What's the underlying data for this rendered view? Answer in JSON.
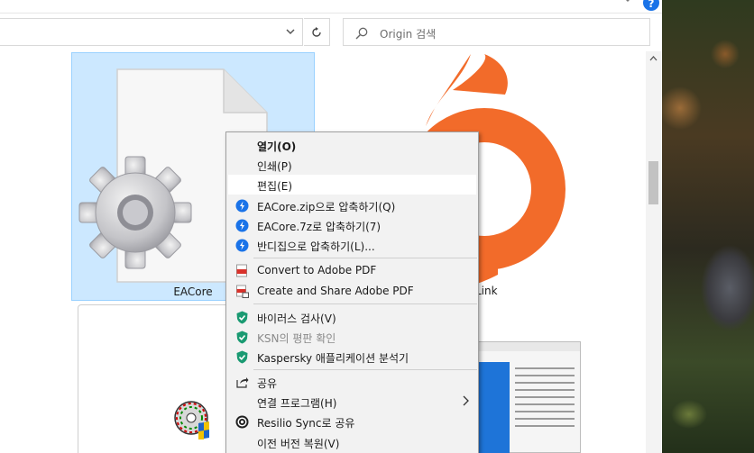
{
  "explorer": {
    "search_placeholder": "Origin 검색",
    "help": "?"
  },
  "files": [
    {
      "name": "EACore",
      "icon": "gear-document-icon",
      "selected": true
    },
    {
      "name": "Link",
      "icon": "origin-logo-icon",
      "selected": false
    }
  ],
  "context_menu": {
    "items": [
      {
        "label": "열기(O)",
        "icon": "",
        "bold": true
      },
      {
        "label": "인쇄(P)",
        "icon": ""
      },
      {
        "label": "편집(E)",
        "icon": "",
        "hover": true
      },
      {
        "label": "EACore.zip으로 압축하기(Q)",
        "icon": "bandizip-icon"
      },
      {
        "label": "EACore.7z로 압축하기(7)",
        "icon": "bandizip-icon"
      },
      {
        "label": "반디집으로 압축하기(L)...",
        "icon": "bandizip-icon"
      },
      {
        "label": "Convert to Adobe PDF",
        "icon": "adobe-pdf-icon"
      },
      {
        "label": "Create and Share Adobe PDF",
        "icon": "adobe-pdf-share-icon"
      },
      {
        "label": "바이러스 검사(V)",
        "icon": "kaspersky-shield-icon"
      },
      {
        "label": "KSN의 평판 확인",
        "icon": "kaspersky-shield-icon",
        "disabled": true
      },
      {
        "label": "Kaspersky 애플리케이션 분석기",
        "icon": "kaspersky-shield-icon"
      },
      {
        "label": "공유",
        "icon": "share-icon"
      },
      {
        "label": "연결 프로그램(H)",
        "icon": "",
        "submenu": true
      },
      {
        "label": "Resilio Sync로 공유",
        "icon": "resilio-sync-icon"
      },
      {
        "label": "이전 버전 복원(V)",
        "icon": ""
      }
    ]
  },
  "colors": {
    "selection": "#cce8ff",
    "origin_orange": "#f26b2a",
    "bandizip_blue": "#1a73e8",
    "kaspersky_green": "#1a9a72",
    "adobe_red": "#d9322b"
  }
}
